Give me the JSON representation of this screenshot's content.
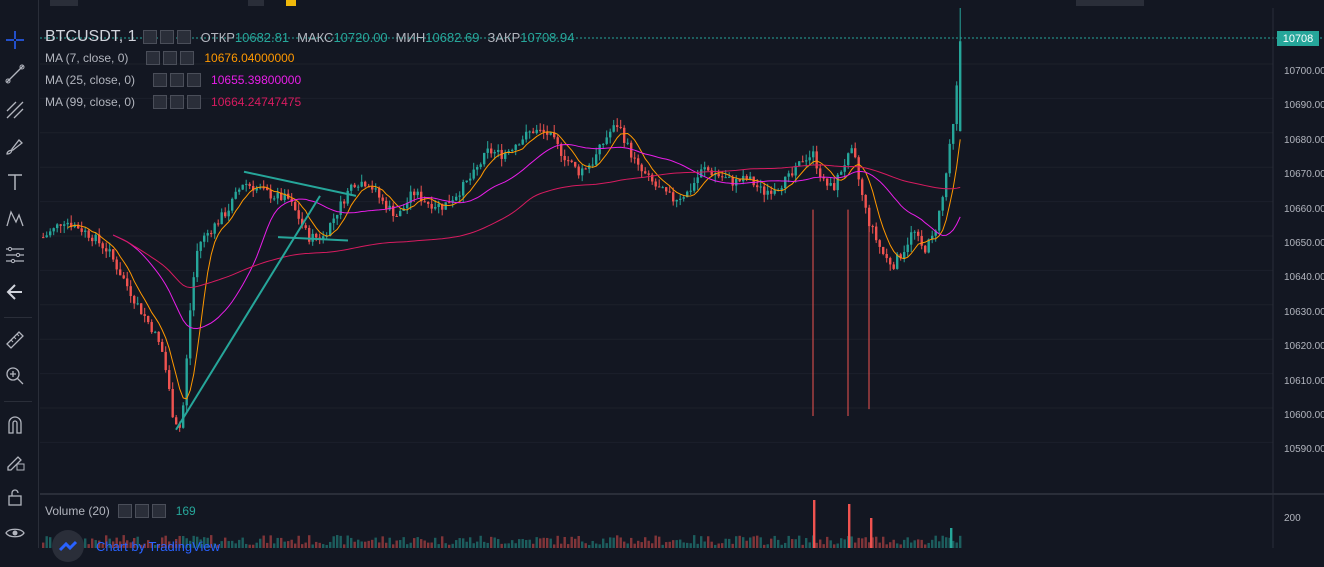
{
  "symbol": {
    "name": "BTCUSDT, 1"
  },
  "ohlc": {
    "open_label": "ОТКР",
    "open_value": "10682.81",
    "high_label": "МАКС",
    "high_value": "10720.00",
    "low_label": "МИН",
    "low_value": "10682.69",
    "close_label": "ЗАКР",
    "close_value": "10708.94"
  },
  "indicators": [
    {
      "name": "MA (7, close, 0)",
      "value": "10676.04000000",
      "color": "#ff9800"
    },
    {
      "name": "MA (25, close, 0)",
      "value": "10655.39800000",
      "color": "#e91ee9"
    },
    {
      "name": "MA (99, close, 0)",
      "value": "10664.24747475",
      "color": "#d81b60"
    }
  ],
  "price_axis": {
    "current_price": "10708",
    "ticks": [
      "10700.00",
      "10690.00",
      "10680.00",
      "10670.00",
      "10660.00",
      "10650.00",
      "10640.00",
      "10630.00",
      "10620.00",
      "10610.00",
      "10600.00",
      "10590.00"
    ]
  },
  "volume": {
    "label": "Volume (20)",
    "value": "169",
    "axis_tick": "200"
  },
  "branding": {
    "text": "Chart by TradingView"
  },
  "colors": {
    "up": "#26a69a",
    "down": "#ef5350",
    "background": "#131722",
    "drawing": "#26a69a"
  },
  "toolbar_icons": [
    "crosshair-icon",
    "trend-line-icon",
    "pitchfork-icon",
    "brush-icon",
    "text-icon",
    "pattern-icon",
    "fib-icon",
    "back-arrow-icon",
    "ruler-icon",
    "zoom-in-icon",
    "magnet-icon",
    "lock-drawing-icon",
    "lock-icon",
    "eye-icon"
  ],
  "chart_data": {
    "type": "candlestick",
    "y_range": [
      10586,
      10722
    ],
    "last_candle": {
      "open": 10682.81,
      "high": 10720.0,
      "low": 10682.69,
      "close": 10708.94
    }
  }
}
